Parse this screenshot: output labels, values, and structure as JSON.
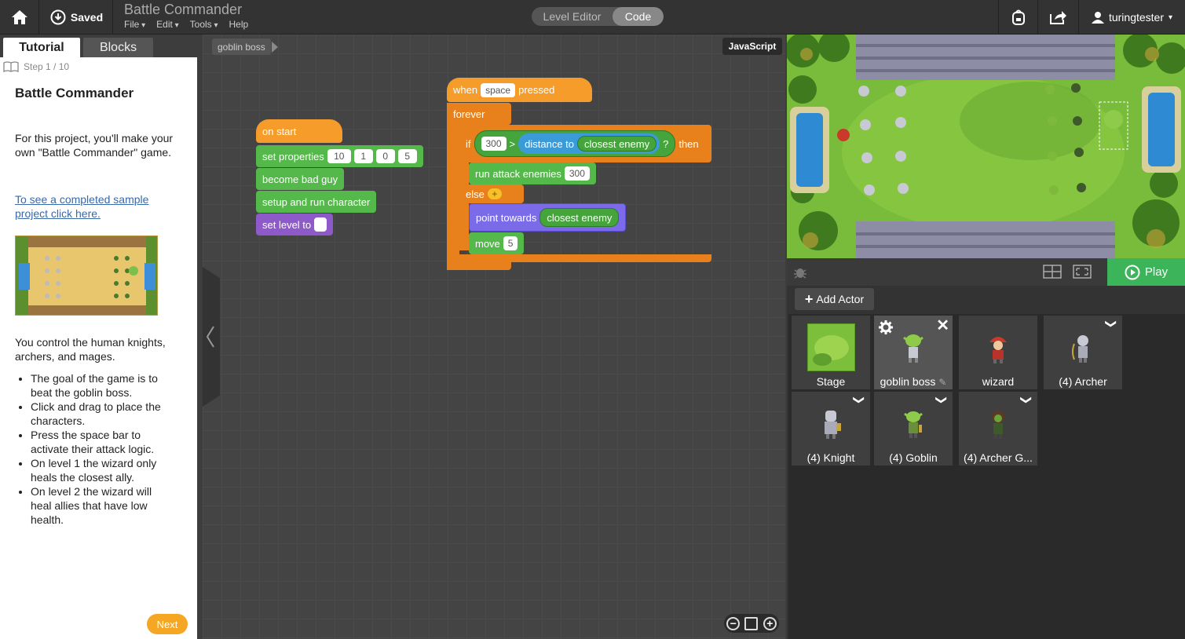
{
  "topbar": {
    "saved_label": "Saved",
    "project_title": "Battle Commander",
    "menus": [
      "File",
      "Edit",
      "Tools",
      "Help"
    ],
    "mode_level_editor": "Level Editor",
    "mode_code": "Code",
    "username": "turingtester"
  },
  "tutorial": {
    "tab_tutorial": "Tutorial",
    "tab_blocks": "Blocks",
    "step": "Step 1 / 10",
    "title": "Battle Commander",
    "intro": "For this project, you'll make your own \"Battle Commander\" game.",
    "link": "To see a completed sample project click here.",
    "control": "You control the human knights, archers, and mages.",
    "bullets": [
      "The goal of the game is to beat the goblin boss.",
      "Click and drag to place the characters.",
      "Press the space bar to activate their attack logic.",
      "On level 1 the wizard only heals the closest ally.",
      "On level 2 the wizard will heal allies that have low health."
    ],
    "next": "Next"
  },
  "code": {
    "sprite_chip": "goblin boss",
    "js_button": "JavaScript",
    "on_start": "on start",
    "set_properties": "set properties",
    "set_properties_values": [
      "10",
      "1",
      "0",
      "5"
    ],
    "become_bad_guy": "become bad guy",
    "setup_run": "setup and run character",
    "set_level_to": "set level to",
    "when": "when",
    "key": "space",
    "pressed": "pressed",
    "forever": "forever",
    "if": "if",
    "if_value": "300",
    "gt": ">",
    "distance_to": "distance to",
    "closest_enemy": "closest enemy",
    "q": "?",
    "then": "then",
    "run_attack": "run attack enemies",
    "run_attack_value": "300",
    "else": "else",
    "point_towards": "point towards",
    "move": "move",
    "move_value": "5"
  },
  "stage_controls": {
    "play": "Play",
    "add_actor": "Add Actor"
  },
  "actors": [
    {
      "label": "Stage"
    },
    {
      "label": "goblin boss"
    },
    {
      "label": "wizard"
    },
    {
      "label": "(4) Archer"
    },
    {
      "label": "(4) Knight"
    },
    {
      "label": "(4) Goblin"
    },
    {
      "label": "(4) Archer G..."
    }
  ],
  "colors": {
    "event": "#f59c2a",
    "control": "#e8801c",
    "green": "#54b94a",
    "purple": "#8e59c9",
    "violet": "#7c6be8",
    "blue": "#3b9bd8",
    "play": "#3cb55a",
    "next": "#f5a623"
  }
}
